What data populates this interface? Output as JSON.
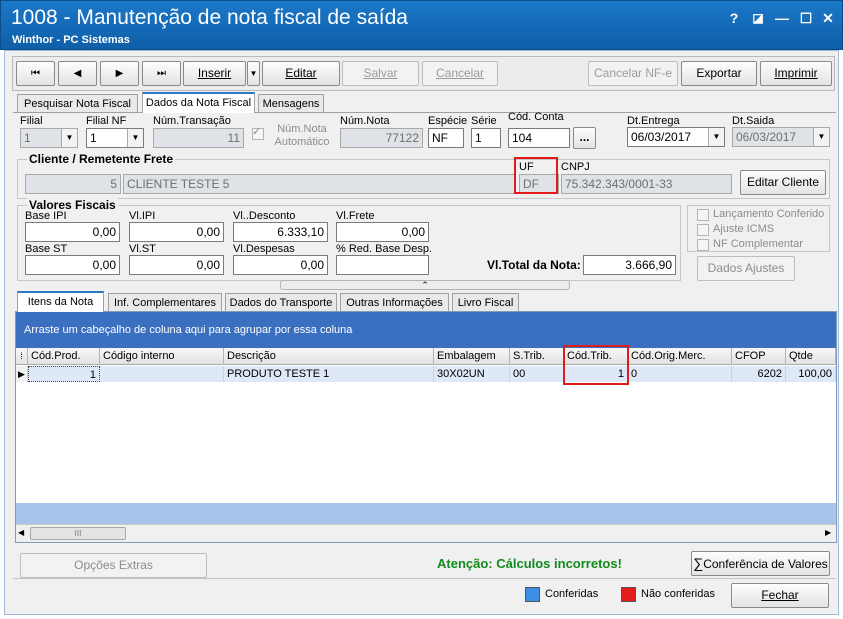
{
  "window": {
    "title": "1008 - Manutenção de nota fiscal de saída",
    "subtitle": "Winthor - PC Sistemas",
    "help_glyph": "?",
    "minimize_glyph": "—",
    "maximize_glyph": "☐",
    "close_glyph": "✕"
  },
  "toolbar": {
    "first": "⏮",
    "prev": "◀",
    "next": "▶",
    "last": "⏭",
    "inserir": "Inserir",
    "editar": "Editar",
    "salvar": "Salvar",
    "cancelar": "Cancelar",
    "cancelar_nfe": "Cancelar NF-e",
    "exportar": "Exportar",
    "imprimir": "Imprimir"
  },
  "tabs_top": [
    "Pesquisar Nota Fiscal",
    "Dados da Nota Fiscal",
    "Mensagens"
  ],
  "header": {
    "filial_label": "Filial",
    "filial_value": "1",
    "filial_nf_label": "Filial NF",
    "filial_nf_value": "1",
    "num_transacao_label": "Núm.Transação",
    "num_transacao_value": "11",
    "num_nota_auto_label": "Núm.Nota Automático",
    "num_nota_label": "Núm.Nota",
    "num_nota_value": "77122",
    "especie_label": "Espécie",
    "especie_value": "NF",
    "serie_label": "Série",
    "serie_value": "1",
    "cod_conta_label": "Cód. Conta",
    "cod_conta_value": "104",
    "cod_conta_btn": "...",
    "dt_entrega_label": "Dt.Entrega",
    "dt_entrega_value": "06/03/2017",
    "dt_saida_label": "Dt.Saida",
    "dt_saida_value": "06/03/2017"
  },
  "cliente": {
    "section": "Cliente / Remetente Frete",
    "code": "5",
    "name": "CLIENTE TESTE 5",
    "uf_label": "UF",
    "uf_value": "DF",
    "cnpj_label": "CNPJ",
    "cnpj_value": "75.342.343/0001-33",
    "editar_btn": "Editar Cliente"
  },
  "valores": {
    "section": "Valores Fiscais",
    "base_ipi_label": "Base IPI",
    "base_ipi": "0,00",
    "vl_ipi_label": "Vl.IPI",
    "vl_ipi": "0,00",
    "vl_desconto_label": "Vl..Desconto",
    "vl_desconto": "6.333,10",
    "vl_frete_label": "Vl.Frete",
    "vl_frete": "0,00",
    "base_st_label": "Base ST",
    "base_st": "0,00",
    "vl_st_label": "Vl.ST",
    "vl_st": "0,00",
    "vl_despesas_label": "Vl.Despesas",
    "vl_despesas": "0,00",
    "red_base_label": "% Red. Base Desp.",
    "red_base": "",
    "vl_total_label": "Vl.Total da Nota:",
    "vl_total": "3.666,90"
  },
  "checks": {
    "lancamento": "Lançamento Conferido",
    "ajuste_icms": "Ajuste ICMS",
    "nf_complementar": "NF Complementar",
    "dados_ajustes": "Dados Ajustes"
  },
  "tabs_bottom": [
    "Itens da Nota",
    "Inf. Complementares",
    "Dados do Transporte",
    "Outras Informações",
    "Livro Fiscal"
  ],
  "grid": {
    "group_hint": "Arraste um cabeçalho de coluna aqui para agrupar por essa coluna",
    "columns": [
      "Cód.Prod.",
      "Código interno",
      "Descrição",
      "Embalagem",
      "S.Trib.",
      "Cód.Trib.",
      "Cód.Orig.Merc.",
      "CFOP",
      "Qtde"
    ],
    "rows": [
      [
        "1",
        "",
        "PRODUTO TESTE 1",
        "30X02UN",
        "00",
        "1",
        "0",
        "6202",
        "100,00"
      ]
    ],
    "scroll_thumb": "III"
  },
  "footer": {
    "opcoes_extras": "Opções Extras",
    "atencao": "Atenção: Cálculos incorretos!",
    "conferencia_btn": "Conferência de Valores",
    "conferidas": "Conferidas",
    "nao_conferidas": "Não conferidas",
    "fechar": "Fechar"
  },
  "colors": {
    "title_bar": "#1568b8",
    "grid_group_bar": "#3b6fc0",
    "atencao_text": "#118a1c",
    "highlight_box": "#e41b1b",
    "conferidas": "#3a8ee6",
    "nao_conferidas": "#e41b1b"
  }
}
